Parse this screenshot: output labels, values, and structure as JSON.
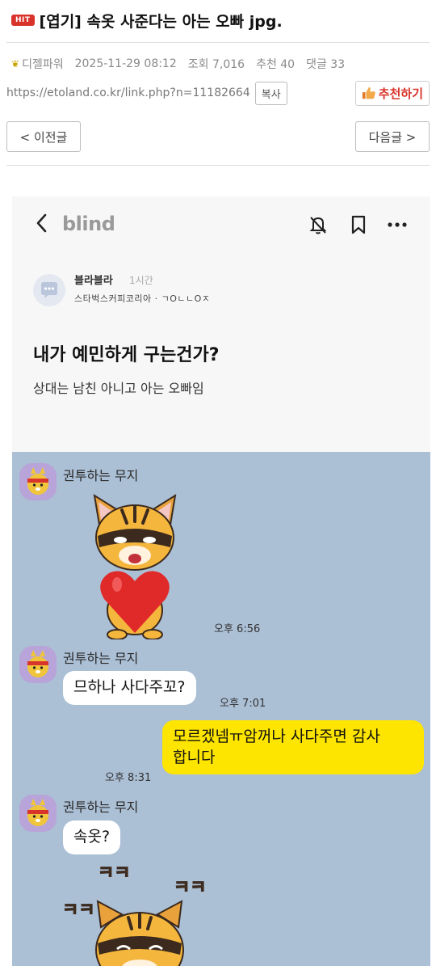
{
  "post": {
    "badge": "HIT",
    "title": "[엽기] 속옷 사준다는 아는 오빠 jpg.",
    "author": "디젤파워",
    "date": "2025-11-29 08:12",
    "views": "조회 7,016",
    "recommends": "추천 40",
    "comments": "댓글 33",
    "link": "https://etoland.co.kr/link.php?n=11182664",
    "copy_label": "복사",
    "recommend_label": "추천하기",
    "prev_label": "< 이전글",
    "next_label": "다음글 >"
  },
  "blind": {
    "logo": "blind",
    "author_name": "블라블라",
    "author_time": "1시간",
    "author_company": "스타벅스커피코리아 · ㄱOㄴㄴOㅈ",
    "heading": "내가 예민하게 구는건가?",
    "body": "상대는 남친 아니고 아는 오빠임"
  },
  "chat": {
    "contact_name": "권투하는 무지",
    "messages": [
      {
        "time": "오후 6:56"
      },
      {
        "text": "므하나 사다주꼬?",
        "time": "오후 7:01"
      },
      {
        "text": "모르겠넴ㅠ암꺼나 사다주면 감사합니다",
        "line1": "모르겠넴ㅠ암꺼나 사다주면 감사",
        "line2": "합니다",
        "time": "오후 8:31"
      },
      {
        "text": "속옷?"
      }
    ]
  },
  "colors": {
    "chat_bg": "#abbfd5",
    "out_bubble": "#fee500",
    "in_bubble": "#ffffff",
    "hit_badge": "#d9342b",
    "recommend_text": "#d9342b"
  }
}
